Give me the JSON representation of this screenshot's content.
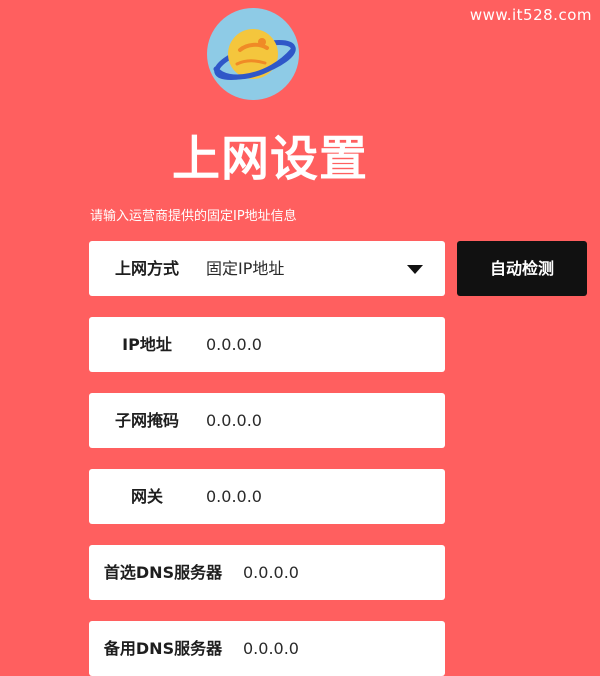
{
  "watermark": "www.it528.com",
  "header": {
    "title": "上网设置",
    "hint": "请输入运营商提供的固定IP地址信息"
  },
  "form": {
    "connection_type": {
      "label": "上网方式",
      "value": "固定IP地址"
    },
    "ip_address": {
      "label": "IP地址",
      "value": "0.0.0.0"
    },
    "subnet_mask": {
      "label": "子网掩码",
      "value": "0.0.0.0"
    },
    "gateway": {
      "label": "网关",
      "value": "0.0.0.0"
    },
    "primary_dns": {
      "label": "首选DNS服务器",
      "value": "0.0.0.0"
    },
    "secondary_dns": {
      "label": "备用DNS服务器",
      "value": "0.0.0.0"
    }
  },
  "buttons": {
    "auto_detect": "自动检测"
  },
  "colors": {
    "background": "#ff5f5f",
    "field": "#ffffff",
    "button": "#111111",
    "logo_circle": "#8ecbe6",
    "planet": "#f4c63d",
    "ring": "#2f57c8"
  },
  "icons": {
    "logo": "planet-icon",
    "dropdown": "chevron-down-icon"
  }
}
